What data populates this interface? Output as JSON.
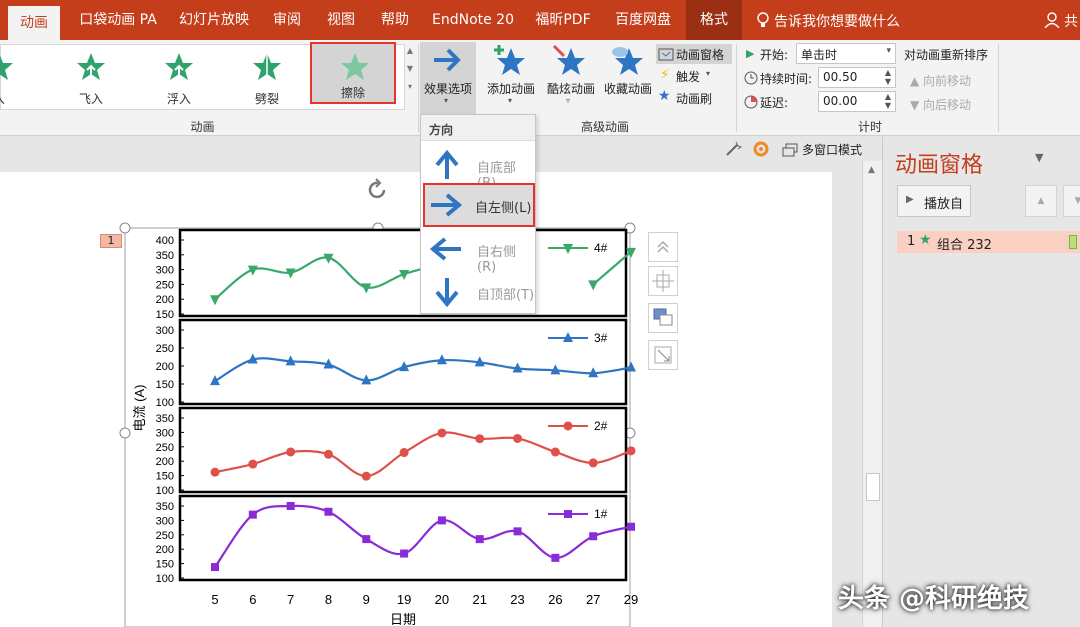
{
  "tabs": [
    {
      "label": "动画",
      "active": true
    },
    {
      "label": "口袋动画 PA"
    },
    {
      "label": "幻灯片放映"
    },
    {
      "label": "审阅"
    },
    {
      "label": "视图"
    },
    {
      "label": "帮助"
    },
    {
      "label": "EndNote 20"
    },
    {
      "label": "福昕PDF"
    },
    {
      "label": "百度网盘"
    },
    {
      "label": "格式"
    }
  ],
  "tell_me": "告诉我你想要做什么",
  "share": "共",
  "ribbon": {
    "animations": [
      "飞入",
      "浮入",
      "劈裂",
      "擦除"
    ],
    "partial_anim": "1入",
    "selected_anim": "擦除",
    "group_animation": "动画",
    "effect_options": "效果选项",
    "add_animation": "添加动画",
    "cool_animation": "酷炫动画",
    "fav_animation": "收藏动画",
    "anim_pane_btn": "动画窗格",
    "trigger": "触发",
    "anim_painter": "动画刷",
    "group_advanced": "高级动画",
    "start_label": "开始:",
    "start_value": "单击时",
    "duration_label": "持续时间:",
    "duration_value": "00.50",
    "delay_label": "延迟:",
    "delay_value": "00.00",
    "reorder": "对动画重新排序",
    "move_earlier": "向前移动",
    "move_later": "向后移动",
    "group_timing": "计时"
  },
  "toolbar2": {
    "multi_window": "多窗口模式"
  },
  "dropdown": {
    "header": "方向",
    "items": [
      {
        "label": "自底部(B)",
        "selected": false
      },
      {
        "label": "自左侧(L)",
        "selected": true
      },
      {
        "label": "自右侧(R)",
        "selected": false
      },
      {
        "label": "自顶部(T)",
        "selected": false
      }
    ]
  },
  "pane": {
    "title": "动画窗格",
    "play_from": "播放自",
    "item_num": "1",
    "item_label": "组合 232"
  },
  "slide": {
    "anim_tag": "1"
  },
  "watermark": "头条 @科研绝技",
  "colors": {
    "accent": "#c43e1c",
    "highlight": "#e8332a",
    "s4": "#3aa86b",
    "s3": "#2e75c3",
    "s2": "#e0504a",
    "s1": "#8a2bd8"
  },
  "chart_data": {
    "type": "line",
    "title": "",
    "xlabel": "日期",
    "ylabel": "电流 (A)",
    "categories": [
      "5",
      "6",
      "7",
      "8",
      "9",
      "19",
      "20",
      "21",
      "23",
      "26",
      "27",
      "29"
    ],
    "series": [
      {
        "name": "4#",
        "marker": "triangle-down",
        "color": "#3aa86b",
        "ylim": [
          150,
          400
        ],
        "ticks": [
          "400",
          "350",
          "300",
          "250",
          "200",
          "150"
        ],
        "values": [
          200,
          300,
          290,
          340,
          240,
          285,
          320,
          null,
          null,
          null,
          250,
          360
        ]
      },
      {
        "name": "3#",
        "marker": "triangle",
        "color": "#2e75c3",
        "ylim": [
          100,
          300
        ],
        "ticks": [
          "300",
          "250",
          "200",
          "150",
          "100"
        ],
        "values": [
          158,
          218,
          213,
          204,
          160,
          197,
          216,
          210,
          193,
          188,
          180,
          196
        ]
      },
      {
        "name": "2#",
        "marker": "circle",
        "color": "#e0504a",
        "ylim": [
          100,
          350
        ],
        "ticks": [
          "350",
          "300",
          "250",
          "200",
          "150",
          "100"
        ],
        "values": [
          162,
          190,
          232,
          224,
          148,
          230,
          298,
          278,
          279,
          232,
          194,
          236
        ]
      },
      {
        "name": "1#",
        "marker": "square",
        "color": "#8a2bd8",
        "ylim": [
          100,
          350
        ],
        "ticks": [
          "350",
          "300",
          "250",
          "200",
          "150",
          "100"
        ],
        "values": [
          138,
          320,
          350,
          330,
          235,
          185,
          300,
          235,
          262,
          170,
          245,
          278
        ]
      }
    ]
  }
}
